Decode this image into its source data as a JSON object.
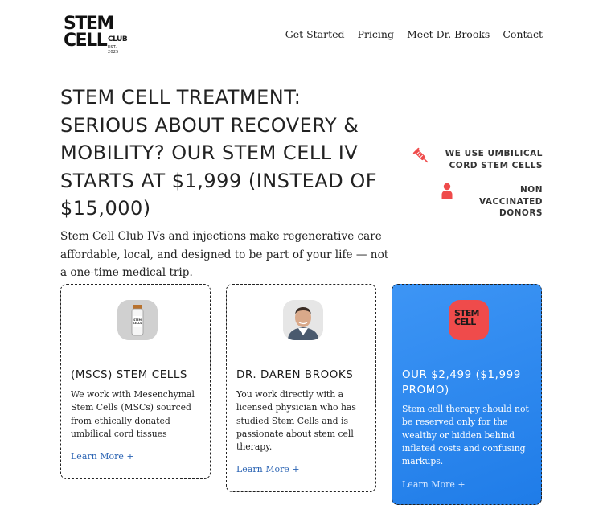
{
  "brand": {
    "logo_line1": "STEM",
    "logo_line2": "CELL",
    "logo_club": "CLUB",
    "logo_est": "EST. 2025"
  },
  "nav": {
    "items": [
      "Get Started",
      "Pricing",
      "Meet Dr. Brooks",
      "Contact"
    ]
  },
  "hero": {
    "headline": "STEM CELL TREATMENT: SERIOUS ABOUT RECOVERY & MOBILITY? OUR STEM CELL IV STARTS AT $1,999 (INSTEAD OF $15,000)",
    "subtext": "Stem Cell Club IVs and injections make regenerative care affordable, local, and designed to be part of your life — not a one-time medical trip."
  },
  "features": [
    {
      "icon": "syringe-icon",
      "text": "WE USE UMBILICAL CORD STEM CELLS"
    },
    {
      "icon": "person-icon",
      "text": "NON VACCINATED DONORS"
    }
  ],
  "cards": [
    {
      "title": "(MSCS) STEM CELLS",
      "body": "We work with Mesenchymal Stem Cells (MSCs) sourced from ethically donated umbilical cord tissues",
      "link": "Learn More +",
      "thumb_label": "STEM CELLS"
    },
    {
      "title": "DR. DAREN BROOKS",
      "body": "You work directly with a licensed physician who has studied Stem Cells and is passionate about stem cell therapy.",
      "link": "Learn More +"
    },
    {
      "title": "OUR $2,499 ($1,999 PROMO)",
      "body": "Stem cell therapy should not be reserved only for the wealthy or hidden behind inflated costs and confusing markups.",
      "link": "Learn More +",
      "thumb_line1": "STEM",
      "thumb_line2": "CELL"
    }
  ],
  "colors": {
    "accent_red": "#ef4b4b",
    "card_blue": "#1f7ce8",
    "link_blue": "#2a63b3"
  }
}
